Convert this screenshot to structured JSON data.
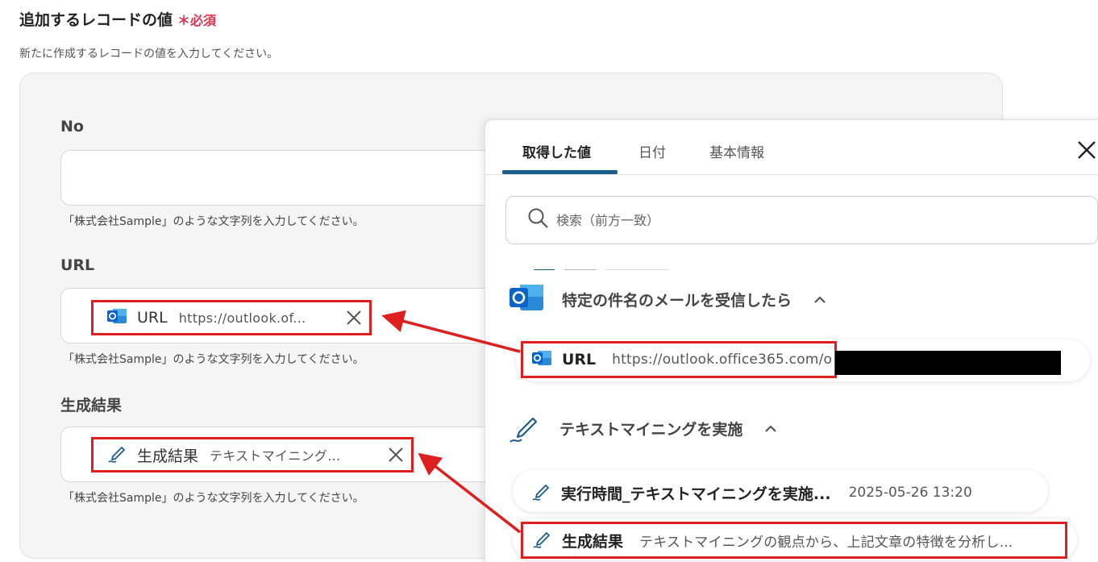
{
  "section": {
    "title": "追加するレコードの値",
    "required_label": "＊必須",
    "description": "新たに作成するレコードの値を入力してください。"
  },
  "fields": [
    {
      "label": "No",
      "hint": "「株式会社Sample」のような文字列を入力してください。"
    },
    {
      "label": "URL",
      "hint": "「株式会社Sample」のような文字列を入力してください。",
      "chip": {
        "icon": "outlook-icon",
        "name": "URL",
        "value": "https://outlook.of..."
      }
    },
    {
      "label": "生成結果",
      "hint": "「株式会社Sample」のような文字列を入力してください。",
      "chip": {
        "icon": "pen-icon",
        "name": "生成結果",
        "value": "テキストマイニング..."
      }
    }
  ],
  "dropdown": {
    "tabs": [
      {
        "label": "取得した値",
        "active": true
      },
      {
        "label": "日付",
        "active": false
      },
      {
        "label": "基本情報",
        "active": false
      }
    ],
    "search_placeholder": "検索（前方一致）",
    "groups": [
      {
        "icon": "outlook-icon",
        "title": "特定の件名のメールを受信したら",
        "expanded": true,
        "items": [
          {
            "name": "URL",
            "value": "https://outlook.office365.com/o",
            "highlighted": true
          }
        ]
      },
      {
        "icon": "pen-icon",
        "title": "テキストマイニングを実施",
        "expanded": true,
        "items": [
          {
            "name": "実行時間_テキストマイニングを実施...",
            "value": "2025-05-26 13:20",
            "highlighted": false
          },
          {
            "name": "生成結果",
            "value": "テキストマイニングの観点から、上記文章の特徴を分析し...",
            "highlighted": true
          }
        ]
      }
    ]
  },
  "colors": {
    "highlight": "#dd1f1f",
    "accent": "#1a5c8c",
    "required": "#e0334f",
    "outlook": "#0a64c8"
  }
}
